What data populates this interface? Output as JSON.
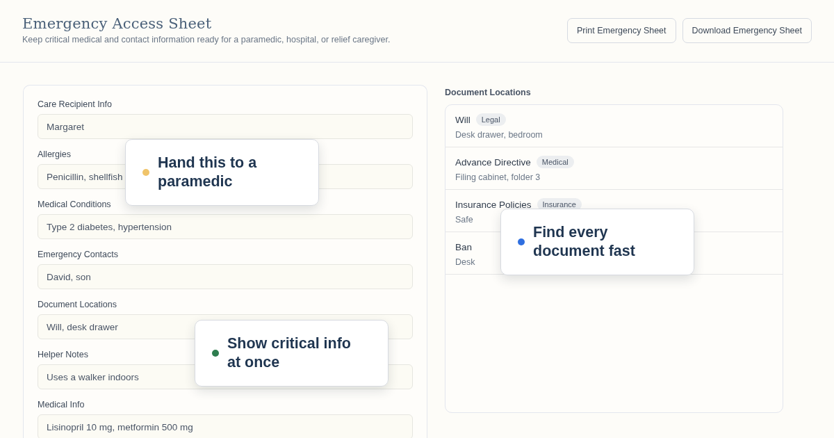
{
  "header": {
    "title": "Emergency Access Sheet",
    "subtitle": "Keep critical medical and contact information ready for a paramedic, hospital, or relief caregiver.",
    "buttons": [
      "Print Emergency Sheet",
      "Download Emergency Sheet"
    ]
  },
  "form": {
    "fields": [
      {
        "label": "Care Recipient Info",
        "value": "Margaret"
      },
      {
        "label": "Allergies",
        "value": "Penicillin, shellfish"
      },
      {
        "label": "Medical Conditions",
        "value": "Type 2 diabetes, hypertension"
      },
      {
        "label": "Emergency Contacts",
        "value": "David, son"
      },
      {
        "label": "Document Locations",
        "value": "Will, desk drawer"
      },
      {
        "label": "Helper Notes",
        "value": "Uses a walker indoors"
      },
      {
        "label": "Medical Info",
        "value": "Lisinopril 10 mg, metformin 500 mg"
      }
    ]
  },
  "documents": {
    "heading": "Document Locations",
    "items": [
      {
        "name": "Will",
        "tag": "Legal",
        "location": "Desk drawer, bedroom"
      },
      {
        "name": "Advance Directive",
        "tag": "Medical",
        "location": "Filing cabinet, folder 3"
      },
      {
        "name": "Insurance Policies",
        "tag": "Insurance",
        "location": "Safe"
      },
      {
        "name": "Ban",
        "location": "Desk"
      }
    ]
  },
  "callouts": [
    {
      "text": "Hand this to a paramedic",
      "color": "#f0c46a"
    },
    {
      "text": "Find every document fast",
      "color": "#2f6fe0"
    },
    {
      "text": "Show critical info at once",
      "color": "#2e7d4f"
    }
  ]
}
